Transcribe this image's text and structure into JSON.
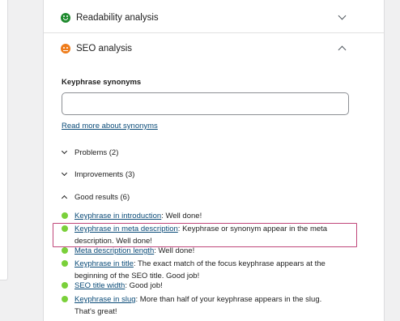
{
  "readability": {
    "title": "Readability analysis",
    "status": "good"
  },
  "seo": {
    "title": "SEO analysis",
    "status": "ok"
  },
  "synonyms": {
    "label": "Keyphrase synonyms",
    "value": "",
    "placeholder": "",
    "read_more": "Read more about synonyms"
  },
  "groups": {
    "problems": "Problems (2)",
    "improvements": "Improvements (3)",
    "good": "Good results (6)"
  },
  "results": [
    {
      "link": "Keyphrase in introduction",
      "text": ": Well done!"
    },
    {
      "link": "Keyphrase in meta description",
      "text": ": Keyphrase or synonym appear in the meta description. Well done!"
    },
    {
      "link": "Meta description length",
      "text": ": Well done!"
    },
    {
      "link": "Keyphrase in title",
      "text": ": The exact match of the focus keyphrase appears at the beginning of the SEO title. Good job!"
    },
    {
      "link": "SEO title width",
      "text": ": Good job!"
    },
    {
      "link": "Keyphrase in slug",
      "text": ": More than half of your keyphrase appears in the slug. That's great!"
    }
  ],
  "colors": {
    "good_dot": "#7ad03a",
    "good_face": "#1e8a2e",
    "ok_face": "#ee7c1b",
    "link": "#0a4b78",
    "highlight": "#c0477a"
  }
}
